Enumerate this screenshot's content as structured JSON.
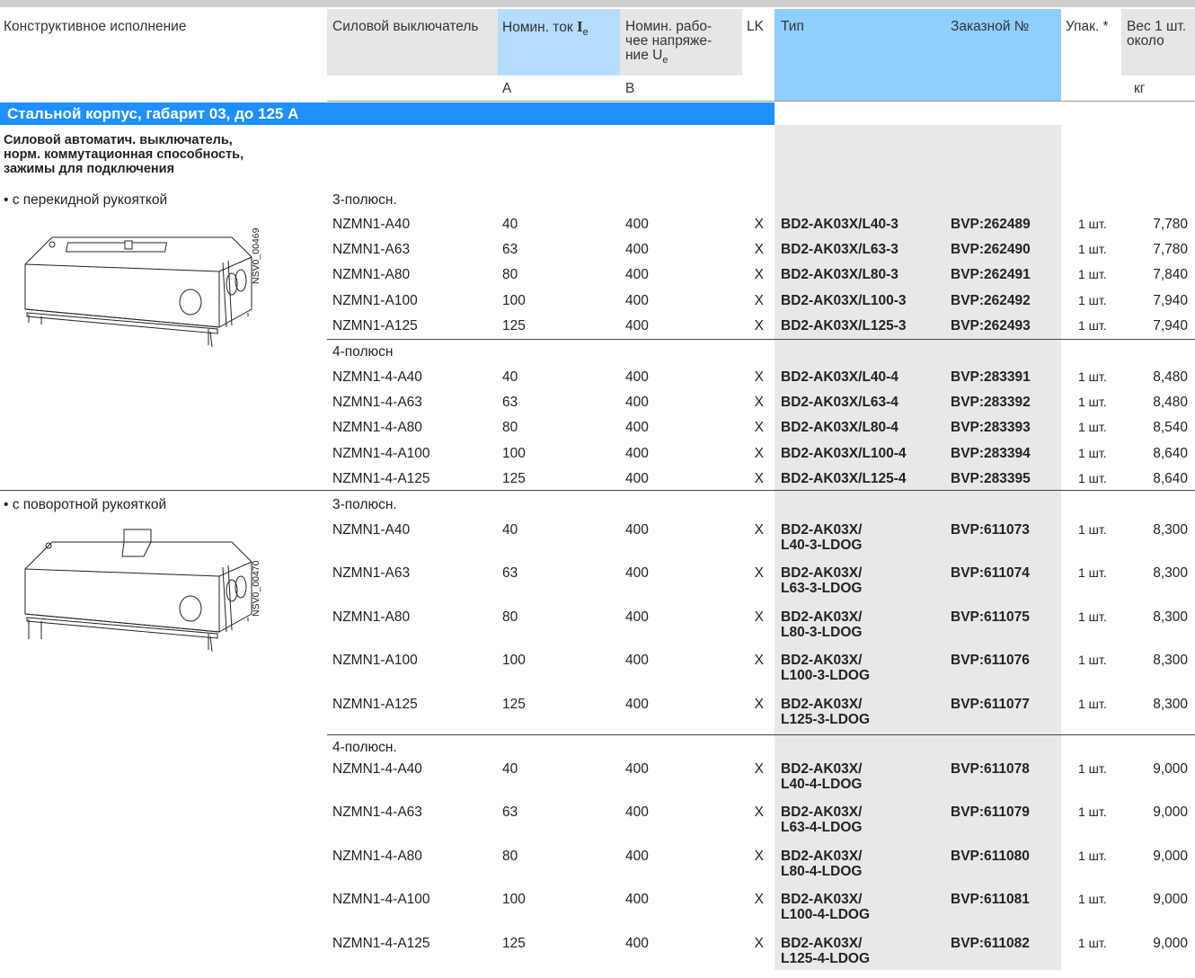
{
  "headers": {
    "design": "Конструктивное исполнение",
    "breaker": "Силовой выключатель",
    "current": "Номин. ток",
    "current_sym": "I",
    "current_sub": "e",
    "voltage_l1": "Номин. рабо-",
    "voltage_l2": "чее напряже-",
    "voltage_l3": "ние U",
    "voltage_sub": "e",
    "lk": "LK",
    "type": "Тип",
    "order": "Заказной №",
    "pack": "Упак. *",
    "weight_l1": "Вес 1 шт.",
    "weight_l2": "около"
  },
  "units": {
    "current": "A",
    "voltage": "B",
    "weight": "кг"
  },
  "section_title": "Стальной корпус, габарит 03, до 125 А",
  "group_desc": [
    "Силовой автоматич. выключатель,",
    "норм. коммутационная способность,",
    "зажимы для подключения"
  ],
  "variant1": {
    "label": "• с перекидной рукояткой",
    "drawing_code": "NSV0_00469",
    "poles3": "3-полюсн.",
    "rows3": [
      {
        "breaker": "NZMN1-A40",
        "current": "40",
        "voltage": "400",
        "lk": "X",
        "type": "BD2-AK03X/L40-3",
        "order": "BVP:262489",
        "pack": "1 шт.",
        "weight": "7,780"
      },
      {
        "breaker": "NZMN1-A63",
        "current": "63",
        "voltage": "400",
        "lk": "X",
        "type": "BD2-AK03X/L63-3",
        "order": "BVP:262490",
        "pack": "1 шт.",
        "weight": "7,780"
      },
      {
        "breaker": "NZMN1-A80",
        "current": "80",
        "voltage": "400",
        "lk": "X",
        "type": "BD2-AK03X/L80-3",
        "order": "BVP:262491",
        "pack": "1 шт.",
        "weight": "7,840"
      },
      {
        "breaker": "NZMN1-A100",
        "current": "100",
        "voltage": "400",
        "lk": "X",
        "type": "BD2-AK03X/L100-3",
        "order": "BVP:262492",
        "pack": "1 шт.",
        "weight": "7,940"
      },
      {
        "breaker": "NZMN1-A125",
        "current": "125",
        "voltage": "400",
        "lk": "X",
        "type": "BD2-AK03X/L125-3",
        "order": "BVP:262493",
        "pack": "1 шт.",
        "weight": "7,940"
      }
    ],
    "poles4": "4-полюсн",
    "rows4": [
      {
        "breaker": "NZMN1-4-A40",
        "current": "40",
        "voltage": "400",
        "lk": "X",
        "type": "BD2-AK03X/L40-4",
        "order": "BVP:283391",
        "pack": "1 шт.",
        "weight": "8,480"
      },
      {
        "breaker": "NZMN1-4-A63",
        "current": "63",
        "voltage": "400",
        "lk": "X",
        "type": "BD2-AK03X/L63-4",
        "order": "BVP:283392",
        "pack": "1 шт.",
        "weight": "8,480"
      },
      {
        "breaker": "NZMN1-4-A80",
        "current": "80",
        "voltage": "400",
        "lk": "X",
        "type": "BD2-AK03X/L80-4",
        "order": "BVP:283393",
        "pack": "1 шт.",
        "weight": "8,540"
      },
      {
        "breaker": "NZMN1-4-A100",
        "current": "100",
        "voltage": "400",
        "lk": "X",
        "type": "BD2-AK03X/L100-4",
        "order": "BVP:283394",
        "pack": "1 шт.",
        "weight": "8,640"
      },
      {
        "breaker": "NZMN1-4-A125",
        "current": "125",
        "voltage": "400",
        "lk": "X",
        "type": "BD2-AK03X/L125-4",
        "order": "BVP:283395",
        "pack": "1 шт.",
        "weight": "8,640"
      }
    ]
  },
  "variant2": {
    "label": "• с поворотной рукояткой",
    "drawing_code": "NSV0_00470",
    "poles3": "3-полюсн.",
    "rows3": [
      {
        "breaker": "NZMN1-A40",
        "current": "40",
        "voltage": "400",
        "lk": "X",
        "type1": "BD2-AK03X/",
        "type2": "L40-3-LDOG",
        "order": "BVP:611073",
        "pack": "1 шт.",
        "weight": "8,300"
      },
      {
        "breaker": "NZMN1-A63",
        "current": "63",
        "voltage": "400",
        "lk": "X",
        "type1": "BD2-AK03X/",
        "type2": "L63-3-LDOG",
        "order": "BVP:611074",
        "pack": "1 шт.",
        "weight": "8,300"
      },
      {
        "breaker": "NZMN1-A80",
        "current": "80",
        "voltage": "400",
        "lk": "X",
        "type1": "BD2-AK03X/",
        "type2": "L80-3-LDOG",
        "order": "BVP:611075",
        "pack": "1 шт.",
        "weight": "8,300"
      },
      {
        "breaker": "NZMN1-A100",
        "current": "100",
        "voltage": "400",
        "lk": "X",
        "type1": "BD2-AK03X/",
        "type2": "L100-3-LDOG",
        "order": "BVP:611076",
        "pack": "1 шт.",
        "weight": "8,300"
      },
      {
        "breaker": "NZMN1-A125",
        "current": "125",
        "voltage": "400",
        "lk": "X",
        "type1": "BD2-AK03X/",
        "type2": "L125-3-LDOG",
        "order": "BVP:611077",
        "pack": "1 шт.",
        "weight": "8,300"
      }
    ],
    "poles4": "4-полюсн.",
    "rows4": [
      {
        "breaker": "NZMN1-4-A40",
        "current": "40",
        "voltage": "400",
        "lk": "X",
        "type1": "BD2-AK03X/",
        "type2": "L40-4-LDOG",
        "order": "BVP:611078",
        "pack": "1 шт.",
        "weight": "9,000"
      },
      {
        "breaker": "NZMN1-4-A63",
        "current": "63",
        "voltage": "400",
        "lk": "X",
        "type1": "BD2-AK03X/",
        "type2": "L63-4-LDOG",
        "order": "BVP:611079",
        "pack": "1 шт.",
        "weight": "9,000"
      },
      {
        "breaker": "NZMN1-4-A80",
        "current": "80",
        "voltage": "400",
        "lk": "X",
        "type1": "BD2-AK03X/",
        "type2": "L80-4-LDOG",
        "order": "BVP:611080",
        "pack": "1 шт.",
        "weight": "9,000"
      },
      {
        "breaker": "NZMN1-4-A100",
        "current": "100",
        "voltage": "400",
        "lk": "X",
        "type1": "BD2-AK03X/",
        "type2": "L100-4-LDOG",
        "order": "BVP:611081",
        "pack": "1 шт.",
        "weight": "9,000"
      },
      {
        "breaker": "NZMN1-4-A125",
        "current": "125",
        "voltage": "400",
        "lk": "X",
        "type1": "BD2-AK03X/",
        "type2": "L125-4-LDOG",
        "order": "BVP:611082",
        "pack": "1 шт.",
        "weight": "9,000"
      }
    ]
  }
}
